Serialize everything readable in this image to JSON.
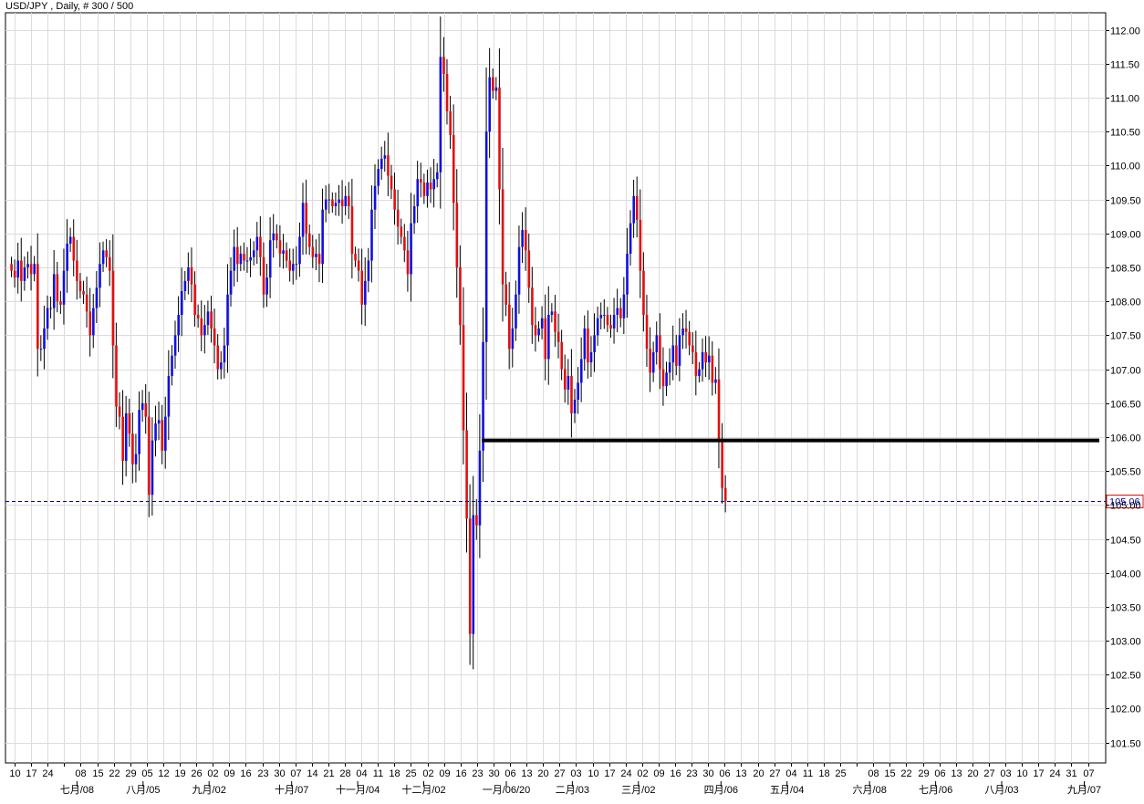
{
  "chart_title": "USD/JPY , Daily, # 300 / 500",
  "colors": {
    "up": "#1010e0",
    "down": "#e01010",
    "grid": "#dcdcdc",
    "support": "#000000",
    "price_line": "#0000a0",
    "price_tag_border": "#e01010"
  },
  "chart_data": {
    "type": "candlestick",
    "title": "USD/JPY , Daily, # 300 / 500",
    "xlabel": "",
    "ylabel": "",
    "ylim": [
      101.2,
      112.25
    ],
    "grid": true,
    "y_ticks": [
      "101.50",
      "102.00",
      "102.50",
      "103.00",
      "103.50",
      "104.00",
      "104.50",
      "105.00",
      "105.50",
      "106.00",
      "106.50",
      "107.00",
      "107.50",
      "108.00",
      "108.50",
      "109.00",
      "109.50",
      "110.00",
      "110.50",
      "111.00",
      "111.50",
      "112.00"
    ],
    "x_ticks": [
      "10",
      "17",
      "24",
      "",
      "08",
      "15",
      "22",
      "29",
      "05",
      "12",
      "19",
      "26",
      "02",
      "09",
      "16",
      "23",
      "30",
      "07",
      "14",
      "21",
      "28",
      "04",
      "11",
      "18",
      "25",
      "02",
      "09",
      "16",
      "23",
      "30",
      "06",
      "13",
      "20",
      "27",
      "03",
      "10",
      "17",
      "24",
      "02",
      "09",
      "16",
      "23",
      "30",
      "06",
      "13",
      "20",
      "27",
      "04",
      "11",
      "18",
      "25",
      "",
      "08",
      "15",
      "22",
      "29",
      "06",
      "13",
      "20",
      "27",
      "03",
      "10",
      "17",
      "24",
      "31",
      "07"
    ],
    "month_labels": [
      "七月/08",
      "八月/05",
      "九月/02",
      "十月/07",
      "十一月/04",
      "十二月/02",
      "一月/06/20",
      "二月/03",
      "三月/02",
      "四月/06",
      "五月/04",
      "六月/08",
      "七月/06",
      "八月/03",
      "九月/07"
    ],
    "month_label_slots": [
      4,
      8,
      12,
      17,
      21,
      25,
      30,
      34,
      38,
      43,
      47,
      52,
      56,
      60,
      65
    ],
    "closes": [
      108.45,
      108.35,
      108.6,
      108.3,
      108.5,
      108.55,
      108.4,
      108.55,
      107.3,
      107.3,
      107.6,
      107.9,
      107.9,
      108.4,
      108.0,
      107.95,
      108.45,
      108.85,
      108.95,
      108.6,
      108.3,
      108.15,
      108.1,
      107.85,
      107.5,
      107.9,
      108.2,
      108.55,
      108.75,
      108.65,
      108.45,
      107.35,
      106.45,
      106.3,
      105.65,
      106.35,
      106.05,
      105.6,
      105.75,
      106.4,
      106.5,
      106.3,
      105.15,
      105.95,
      106.2,
      106.25,
      105.8,
      106.3,
      106.9,
      107.2,
      107.5,
      107.8,
      108.15,
      108.3,
      108.5,
      108.25,
      107.8,
      107.75,
      107.5,
      107.65,
      107.85,
      107.6,
      107.35,
      107.0,
      107.1,
      107.35,
      108.1,
      108.45,
      108.8,
      108.55,
      108.7,
      108.6,
      108.6,
      108.65,
      108.75,
      108.95,
      108.65,
      108.1,
      108.35,
      108.9,
      109.0,
      108.9,
      108.7,
      108.75,
      108.6,
      108.45,
      108.55,
      108.55,
      108.95,
      109.45,
      109.0,
      108.8,
      108.65,
      108.7,
      108.55,
      109.35,
      109.5,
      109.5,
      109.4,
      109.45,
      109.5,
      109.4,
      109.55,
      109.4,
      108.7,
      108.6,
      108.45,
      107.95,
      108.3,
      108.6,
      109.35,
      109.7,
      109.95,
      110.1,
      110.15,
      109.85,
      109.65,
      109.35,
      109.1,
      108.95,
      108.75,
      108.4,
      109.15,
      109.4,
      109.8,
      109.75,
      109.55,
      109.75,
      109.65,
      109.8,
      109.9,
      111.6,
      111.35,
      110.8,
      110.45,
      109.45,
      108.5,
      107.65,
      106.1,
      104.8,
      103.1,
      104.85,
      104.7,
      105.8,
      107.4,
      110.5,
      111.3,
      111.1,
      111.15,
      109.65,
      108.25,
      107.95,
      107.3,
      107.6,
      108.1,
      108.8,
      109.05,
      108.75,
      108.2,
      107.65,
      107.5,
      107.6,
      107.75,
      107.15,
      107.8,
      107.85,
      107.55,
      107.4,
      107.0,
      106.7,
      106.9,
      106.35,
      106.55,
      106.8,
      107.15,
      107.6,
      107.1,
      107.25,
      107.5,
      107.75,
      107.8,
      107.8,
      107.65,
      107.6,
      107.8,
      107.9,
      107.75,
      108.1,
      108.7,
      109.15,
      109.55,
      109.2,
      108.45,
      107.8,
      107.3,
      106.95,
      107.25,
      107.5,
      107.0,
      106.75,
      106.95,
      107.1,
      107.35,
      107.05,
      107.5,
      107.6,
      107.55,
      107.35,
      107.25,
      106.9,
      107.0,
      107.25,
      107.1,
      107.2,
      106.8,
      106.85,
      105.95,
      105.25,
      105.06
    ],
    "support_level": 105.95,
    "support_start_index": 144,
    "current_price": 105.06,
    "current_price_label": "105.06"
  }
}
